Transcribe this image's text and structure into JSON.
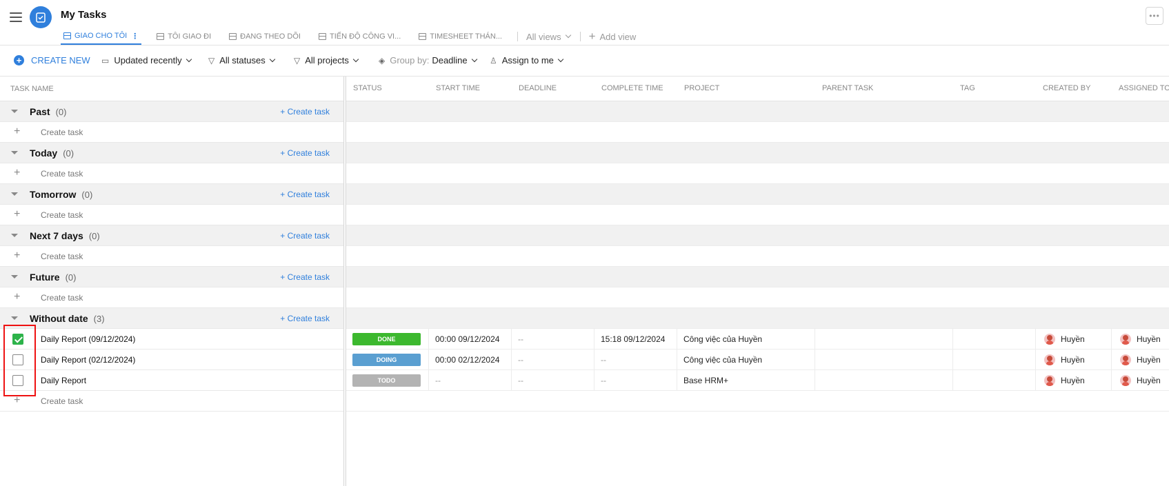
{
  "header": {
    "title": "My Tasks",
    "tabs": [
      {
        "label": "GIAO CHO TÔI",
        "active": true
      },
      {
        "label": "TÔI GIAO ĐI"
      },
      {
        "label": "ĐANG THEO DÕI"
      },
      {
        "label": "TIẾN ĐỘ CÔNG VI..."
      },
      {
        "label": "TIMESHEET THÁN..."
      }
    ],
    "all_views": "All views",
    "add_view": "Add view",
    "more": "•••"
  },
  "toolbar": {
    "create_new": "CREATE NEW",
    "sort": "Updated recently",
    "statuses": "All statuses",
    "projects": "All projects",
    "group_by_label": "Group by:",
    "group_by_value": "Deadline",
    "assign": "Assign to me"
  },
  "left": {
    "column_header": "TASK NAME",
    "create_task": "+ Create task",
    "add_task_label": "Create task",
    "groups": [
      {
        "name": "Past",
        "count": "(0)"
      },
      {
        "name": "Today",
        "count": "(0)"
      },
      {
        "name": "Tomorrow",
        "count": "(0)"
      },
      {
        "name": "Next 7 days",
        "count": "(0)"
      },
      {
        "name": "Future",
        "count": "(0)"
      },
      {
        "name": "Without date",
        "count": "(3)"
      }
    ],
    "tasks": [
      {
        "name": "Daily Report (09/12/2024)",
        "checked": true
      },
      {
        "name": "Daily Report (02/12/2024)",
        "checked": false
      },
      {
        "name": "Daily Report",
        "checked": false
      }
    ]
  },
  "right": {
    "columns": [
      "STATUS",
      "START TIME",
      "DEADLINE",
      "COMPLETE TIME",
      "PROJECT",
      "PARENT TASK",
      "TAG",
      "CREATED BY",
      "ASSIGNED TO"
    ],
    "rows": [
      {
        "status": "DONE",
        "status_color": "#3cb82e",
        "start": "00:00 09/12/2024",
        "deadline": "--",
        "complete": "15:18 09/12/2024",
        "project": "Công việc của Huyền",
        "created_by": "Huyền",
        "assigned_to": "Huyền"
      },
      {
        "status": "DOING",
        "status_color": "#5a9fd1",
        "start": "00:00 02/12/2024",
        "deadline": "--",
        "complete": "--",
        "project": "Công việc của Huyền",
        "created_by": "Huyền",
        "assigned_to": "Huyền"
      },
      {
        "status": "TODO",
        "status_color": "#b3b3b3",
        "start": "--",
        "deadline": "--",
        "complete": "--",
        "project": "Base HRM+",
        "created_by": "Huyền",
        "assigned_to": "Huyền"
      }
    ]
  },
  "colors": {
    "accent": "#2f7fdc",
    "done": "#3cb82e",
    "doing": "#5a9fd1",
    "todo": "#b3b3b3",
    "highlight": "#e11111"
  }
}
